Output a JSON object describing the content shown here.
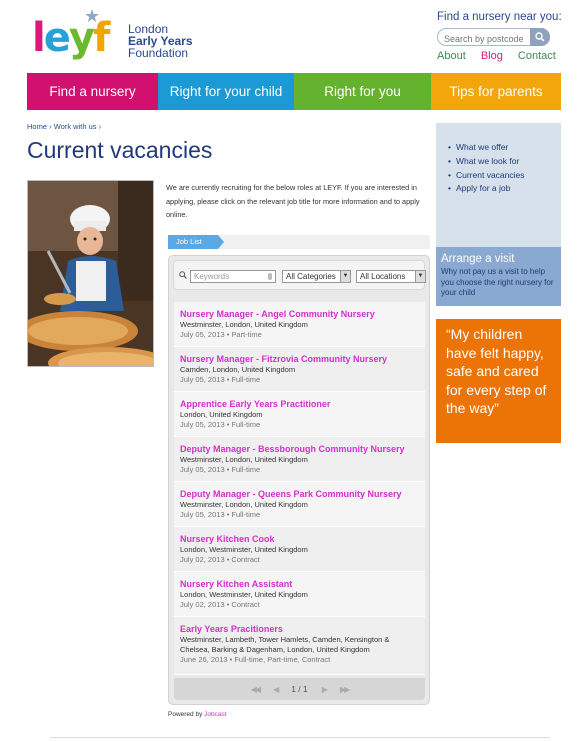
{
  "brand": {
    "logo_letters": [
      "l",
      "e",
      "y",
      "f"
    ],
    "name_line1": "London",
    "name_line2": "Early Years",
    "name_line3": "Foundation",
    "colors": {
      "pink": "#d1106f",
      "blue": "#1b9ad6",
      "green": "#64b22d",
      "yellow": "#f2a60c",
      "navy": "#1f3a7a",
      "orange": "#ec7407"
    }
  },
  "header": {
    "find_label": "Find a nursery near you:",
    "search_placeholder": "Search by postcode",
    "search_icon": "magnifier-icon",
    "links": {
      "about": "About",
      "blog": "Blog",
      "contact": "Contact"
    }
  },
  "nav": {
    "items": [
      "Find a nursery",
      "Right for your child",
      "Right for you",
      "Tips for parents"
    ]
  },
  "breadcrumb": {
    "home": "Home",
    "sep": "›",
    "work": "Work with us"
  },
  "page_title": "Current vacancies",
  "intro": "We are currently recruiting for the below roles at LEYF. If you are interested in applying, please click on the relevant job title for more information and to apply online.",
  "job_list": {
    "tab_label": "Job List",
    "keyword_placeholder": "Keywords",
    "category_select": "All Categories",
    "location_select": "All Locations",
    "jobs": [
      {
        "title": "Nursery Manager - Angel Community Nursery",
        "location": "Westminster, London, United Kingdom",
        "meta": "July 05, 2013 • Part-time"
      },
      {
        "title": "Nursery Manager - Fitzrovia Community Nursery",
        "location": "Camden, London, United Kingdom",
        "meta": "July 05, 2013 • Full-time"
      },
      {
        "title": "Apprentice Early Years Practitioner",
        "location": "London, United Kingdom",
        "meta": "July 05, 2013 • Full-time"
      },
      {
        "title": "Deputy Manager - Bessborough Community Nursery",
        "location": "Westminster, London, United Kingdom",
        "meta": "July 05, 2013 • Full-time"
      },
      {
        "title": "Deputy Manager - Queens Park Community Nursery",
        "location": "Westminster, London, United Kingdom",
        "meta": "July 05, 2013 • Full-time"
      },
      {
        "title": "Nursery Kitchen Cook",
        "location": "London, Westminster, United Kingdom",
        "meta": "July 02, 2013 • Contract"
      },
      {
        "title": "Nursery Kitchen Assistant",
        "location": "London, Westminster, United Kingdom",
        "meta": "July 02, 2013 • Contract"
      },
      {
        "title": "Early Years Pracitioners",
        "location": "Westminster, Lambeth, Tower Hamlets, Camden, Kensington & Chelsea, Barking & Dagenham, London, United Kingdom",
        "meta": "June 26, 2013 • Full-time, Part-time, Contract"
      }
    ],
    "pager": {
      "first": "◀◀",
      "prev": "◀",
      "page": "1 / 1",
      "next": "▶",
      "last": "▶▶"
    },
    "powered_by": "Powered by",
    "powered_link": "Jobcast"
  },
  "sidebar": {
    "links": [
      "What we offer",
      "What we look for",
      "Current vacancies",
      "Apply for a job"
    ],
    "arrange_title": "Arrange a visit",
    "arrange_text": "Why not pay us a visit to help you choose the right nursery for your child",
    "quote": "“My children have felt happy, safe and cared for every step of the way”"
  }
}
